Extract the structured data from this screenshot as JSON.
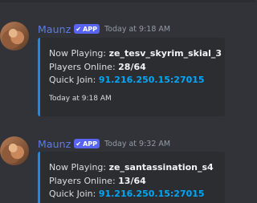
{
  "messages": [
    {
      "username": "Maunz",
      "badge": "APP",
      "timestamp": "Today at 9:18 AM",
      "embed": {
        "now_playing_label": "Now Playing:",
        "now_playing_value": "ze_tesv_skyrim_skial_3",
        "players_label": "Players Online:",
        "players_value": "28/64",
        "quick_join_label": "Quick Join:",
        "quick_join_value": "91.216.250.15:27015",
        "footer": "Today at 9:18 AM"
      }
    },
    {
      "username": "Maunz",
      "badge": "APP",
      "timestamp": "Today at 9:32 AM",
      "embed": {
        "now_playing_label": "Now Playing:",
        "now_playing_value": "ze_santassination_s4",
        "players_label": "Players Online:",
        "players_value": "13/64",
        "quick_join_label": "Quick Join:",
        "quick_join_value": "91.216.250.15:27015"
      }
    }
  ],
  "colors": {
    "background": "#313338",
    "embed_background": "#2b2d31",
    "embed_accent": "#1e88e5",
    "username": "#5b7cf0",
    "badge": "#5865f2",
    "link": "#00a8fc",
    "timestamp": "#949ba4"
  },
  "icons": {
    "badge_check": "checkmark-icon",
    "avatar": "cat-avatar"
  }
}
